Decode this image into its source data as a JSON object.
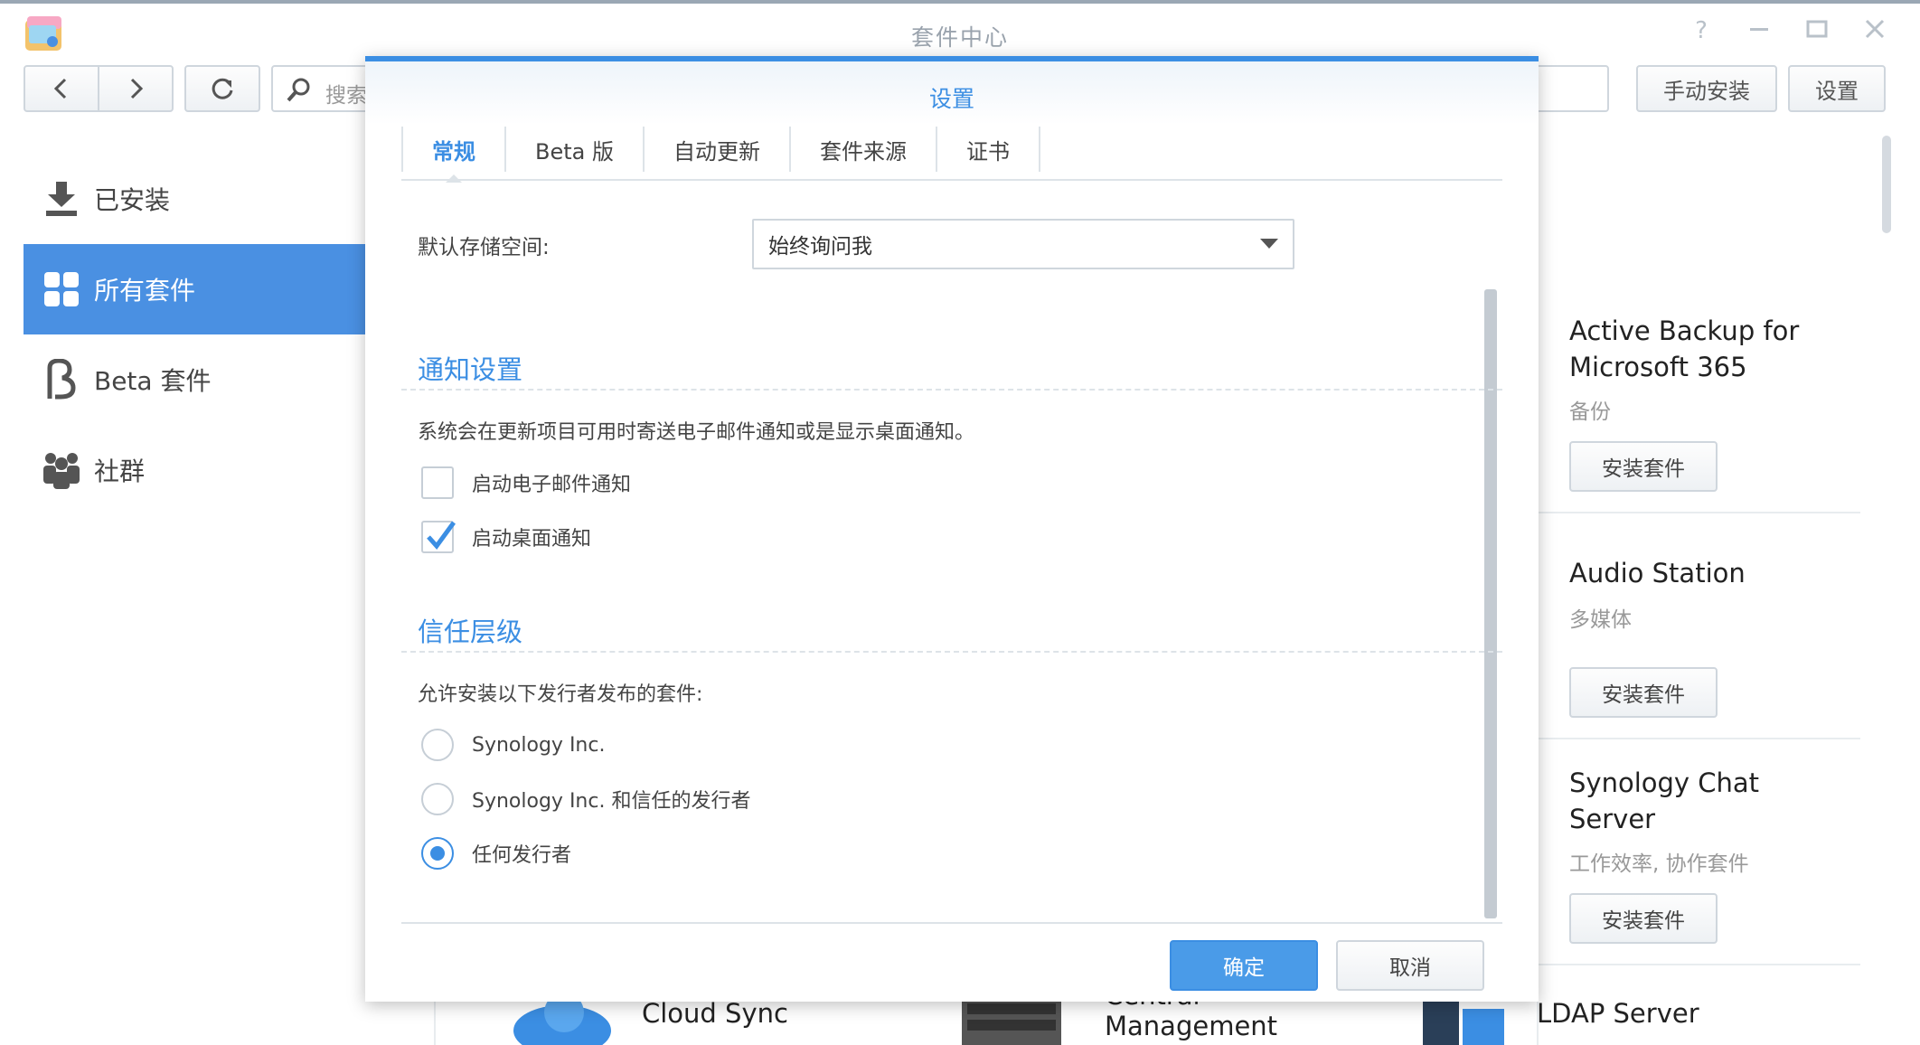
{
  "window": {
    "title": "套件中心",
    "help_icon": "help-icon",
    "minimize_icon": "minimize-icon",
    "maximize_icon": "maximize-icon",
    "close_icon": "close-icon"
  },
  "toolbar": {
    "search_placeholder": "搜索",
    "manual_install_label": "手动安装",
    "settings_label": "设置"
  },
  "sidebar": {
    "items": [
      {
        "label": "已安装",
        "icon": "download-icon"
      },
      {
        "label": "所有套件",
        "icon": "grid-icon"
      },
      {
        "label": "Beta 套件",
        "icon": "beta-icon"
      },
      {
        "label": "社群",
        "icon": "community-icon"
      }
    ],
    "active_index": 1
  },
  "packages": [
    {
      "name": "Active Backup for Microsoft 365",
      "category": "备份",
      "button": "安装套件"
    },
    {
      "name": "Audio Station",
      "category": "多媒体",
      "button": "安装套件"
    },
    {
      "name": "Synology Chat Server",
      "category": "工作效率, 协作套件",
      "button": "安装套件"
    }
  ],
  "bottom_apps": [
    "Cloud Sync",
    "Central Management",
    "LDAP Server"
  ],
  "dialog": {
    "title": "设置",
    "tabs": [
      "常规",
      "Beta 版",
      "自动更新",
      "套件来源",
      "证书"
    ],
    "active_tab": 0,
    "default_storage_label": "默认存储空间:",
    "default_storage_value": "始终询问我",
    "notification": {
      "title": "通知设置",
      "description": "系统会在更新项目可用时寄送电子邮件通知或是显示桌面通知。",
      "email_label": "启动电子邮件通知",
      "email_checked": false,
      "desktop_label": "启动桌面通知",
      "desktop_checked": true
    },
    "trust": {
      "title": "信任层级",
      "description": "允许安装以下发行者发布的套件:",
      "options": [
        "Synology Inc.",
        "Synology Inc. 和信任的发行者",
        "任何发行者"
      ],
      "selected_index": 2
    },
    "ok_label": "确定",
    "cancel_label": "取消"
  },
  "colors": {
    "accent": "#3b8ee3",
    "sidebar_active": "#4a90e2"
  }
}
